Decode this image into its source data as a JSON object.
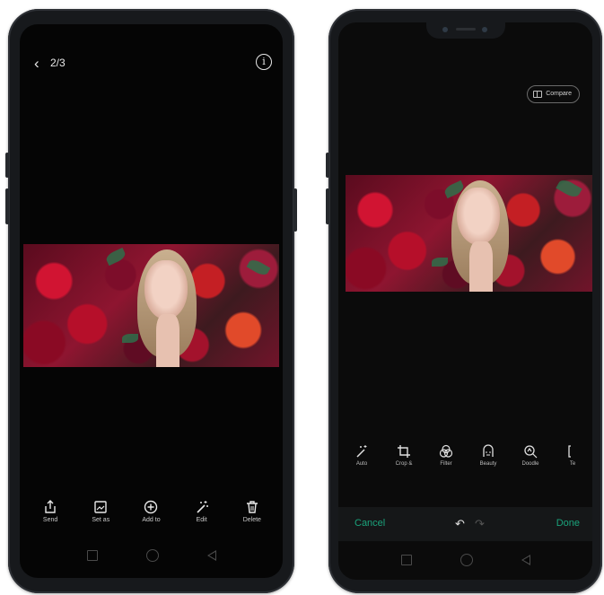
{
  "viewer": {
    "back_icon": "chevron-left-icon",
    "page_count": "2/3",
    "info_icon": "info-icon",
    "actions": [
      {
        "label": "Send",
        "icon": "share-icon"
      },
      {
        "label": "Set as",
        "icon": "image-icon"
      },
      {
        "label": "Add to",
        "icon": "plus-circle-icon"
      },
      {
        "label": "Edit",
        "icon": "magic-wand-icon"
      },
      {
        "label": "Delete",
        "icon": "trash-icon"
      }
    ]
  },
  "editor": {
    "compare_label": "Compare",
    "tools": [
      {
        "label": "Auto",
        "icon": "magic-wand-icon"
      },
      {
        "label": "Crop &",
        "icon": "crop-icon"
      },
      {
        "label": "Filter",
        "icon": "filter-icon"
      },
      {
        "label": "Beauty",
        "icon": "beauty-icon"
      },
      {
        "label": "Doodle",
        "icon": "doodle-icon"
      },
      {
        "label": "Te",
        "icon": "text-icon"
      }
    ],
    "cancel_label": "Cancel",
    "done_label": "Done",
    "undo_glyph": "↶",
    "redo_glyph": "↷"
  },
  "colors": {
    "accent": "#1aa37b",
    "screen_bg": "#050505",
    "frame": "#17191c"
  }
}
